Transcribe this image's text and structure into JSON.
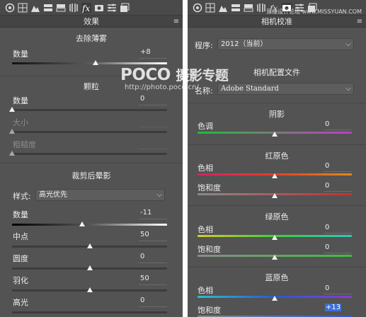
{
  "left": {
    "header": "效果",
    "dehaze": {
      "title": "去除薄雾",
      "amount_label": "数量",
      "amount_value": "+8",
      "amount_level": 0.54
    },
    "grain": {
      "title": "颗粒",
      "amount_label": "数量",
      "amount_value": "0",
      "amount_level": 0.0,
      "size_label": "大小",
      "roughness_label": "粗糙度"
    },
    "vignette": {
      "title": "裁剪后晕影",
      "style_label": "样式:",
      "style_value": "高光优先",
      "amount_label": "数量",
      "amount_value": "-11",
      "amount_level": 0.45,
      "midpoint_label": "中点",
      "midpoint_value": "50",
      "midpoint_level": 0.5,
      "roundness_label": "圆度",
      "roundness_value": "0",
      "roundness_level": 0.5,
      "feather_label": "羽化",
      "feather_value": "50",
      "feather_level": 0.5,
      "highlights_label": "高光",
      "highlights_value": "0"
    }
  },
  "right": {
    "header": "相机校准",
    "process_label": "程序:",
    "process_value": "2012（当前）",
    "profile_title": "相机配置文件",
    "profile_label": "名称:",
    "profile_value": "Adobe Standard",
    "shadows": {
      "title": "阴影",
      "tint_label": "色调",
      "tint_value": "0",
      "tint_level": 0.5
    },
    "red": {
      "title": "红原色",
      "hue_label": "色相",
      "hue_value": "0",
      "hue_level": 0.5,
      "sat_label": "饱和度",
      "sat_value": "0",
      "sat_level": 0.5
    },
    "green": {
      "title": "绿原色",
      "hue_label": "色相",
      "hue_value": "0",
      "hue_level": 0.5,
      "sat_label": "饱和度",
      "sat_value": "0",
      "sat_level": 0.5
    },
    "blue": {
      "title": "蓝原色",
      "hue_label": "色相",
      "hue_value": "0",
      "hue_level": 0.5,
      "sat_label": "饱和度",
      "sat_value": "+13",
      "sat_level": 0.56
    }
  },
  "watermark": {
    "logo": "POCO",
    "logo_suffix": "摄影专题",
    "url": "http://photo.poco.cn/"
  },
  "credit": "思缘设计论坛 www.MISSYUAN.COM",
  "icons": [
    "basic-icon",
    "tone-curve-icon",
    "detail-icon",
    "hsl-icon",
    "split-toning-icon",
    "lens-corrections-icon",
    "effects-icon",
    "camera-calibration-icon",
    "presets-icon",
    "snapshots-icon"
  ],
  "colors": {
    "panel": "#535353",
    "header": "#444444",
    "selection": "#3b6fd4"
  }
}
